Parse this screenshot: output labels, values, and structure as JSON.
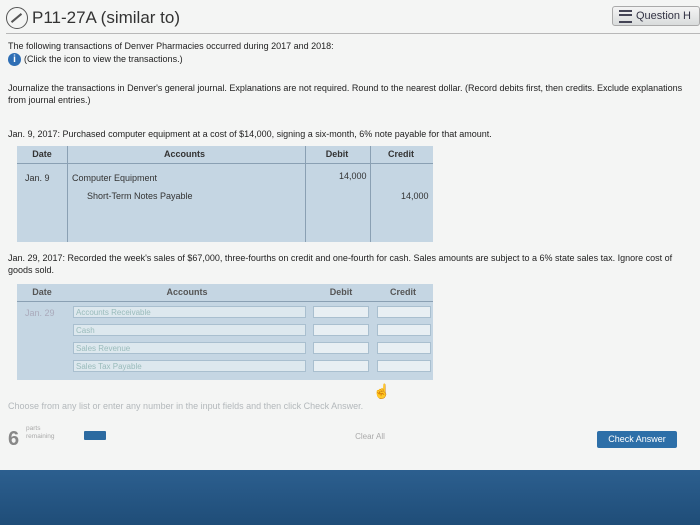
{
  "header": {
    "title": "P11-27A (similar to)",
    "question_label": "Question H"
  },
  "intro": {
    "line1": "The following transactions of Denver Pharmacies occurred during 2017 and 2018:",
    "click_label": "(Click the icon to view the transactions.)",
    "instructions": "Journalize the transactions in Denver's general journal. Explanations are not required. Round to the nearest dollar. (Record debits first, then credits. Exclude explanations from journal entries.)"
  },
  "entry1": {
    "description": "Jan. 9, 2017: Purchased computer equipment at a cost of $14,000, signing a six-month, 6% note payable for that amount.",
    "headers": {
      "date": "Date",
      "accounts": "Accounts",
      "debit": "Debit",
      "credit": "Credit"
    },
    "date": "Jan. 9",
    "rows": [
      {
        "account": "Computer Equipment",
        "debit": "14,000",
        "credit": ""
      },
      {
        "account": "Short-Term Notes Payable",
        "debit": "",
        "credit": "14,000"
      }
    ]
  },
  "entry2": {
    "description": "Jan. 29, 2017: Recorded the week's sales of $67,000, three-fourths on credit and one-fourth for cash. Sales amounts are subject to a 6% state sales tax. Ignore cost of goods sold.",
    "headers": {
      "date": "Date",
      "accounts": "Accounts",
      "debit": "Debit",
      "credit": "Credit"
    },
    "date": "Jan. 29",
    "rows": [
      {
        "account": "Accounts Receivable"
      },
      {
        "account": "Cash"
      },
      {
        "account": "Sales Revenue"
      },
      {
        "account": "Sales Tax Payable"
      }
    ]
  },
  "hint": "Choose from any list or enter any number in the input fields and then click Check Answer.",
  "footer": {
    "parts_count": "6",
    "parts_label": "parts remaining",
    "clear_label": "Clear All",
    "check_label": "Check Answer"
  }
}
